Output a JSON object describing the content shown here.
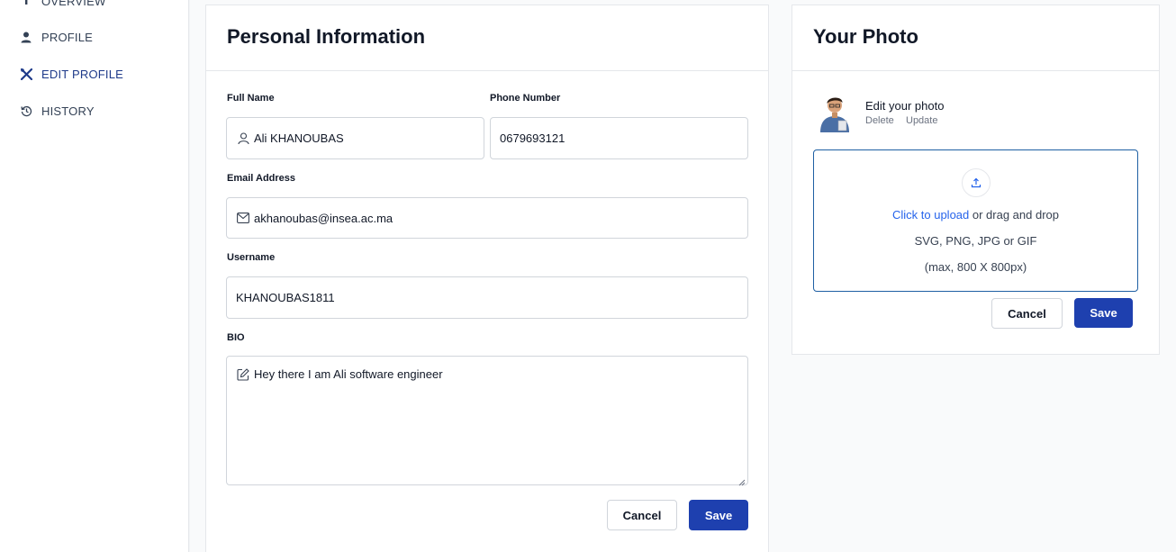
{
  "sidebar": {
    "items": [
      {
        "label": "OVERVIEW",
        "icon": "info-icon"
      },
      {
        "label": "PROFILE",
        "icon": "user-icon"
      },
      {
        "label": "EDIT PROFILE",
        "icon": "tools-icon",
        "active": true
      },
      {
        "label": "HISTORY",
        "icon": "history-icon"
      }
    ]
  },
  "personal": {
    "title": "Personal Information",
    "full_name_label": "Full Name",
    "full_name_value": "Ali KHANOUBAS",
    "phone_label": "Phone Number",
    "phone_value": "0679693121",
    "email_label": "Email Address",
    "email_value": "akhanoubas@insea.ac.ma",
    "username_label": "Username",
    "username_value": "KHANOUBAS1811",
    "bio_label": "BIO",
    "bio_value": "Hey there I am Ali software engineer",
    "cancel_label": "Cancel",
    "save_label": "Save"
  },
  "photo": {
    "title": "Your Photo",
    "edit_label": "Edit your photo",
    "delete_label": "Delete",
    "update_label": "Update",
    "upload_link": "Click to upload",
    "upload_rest": " or drag and drop",
    "formats": "SVG, PNG, JPG or GIF",
    "max_size": "(max, 800 X 800px)",
    "cancel_label": "Cancel",
    "save_label": "Save"
  },
  "colors": {
    "primary": "#1e40af",
    "active_nav": "#1e3a8a",
    "link": "#2563eb",
    "dropzone_border": "#1e5fa3"
  }
}
